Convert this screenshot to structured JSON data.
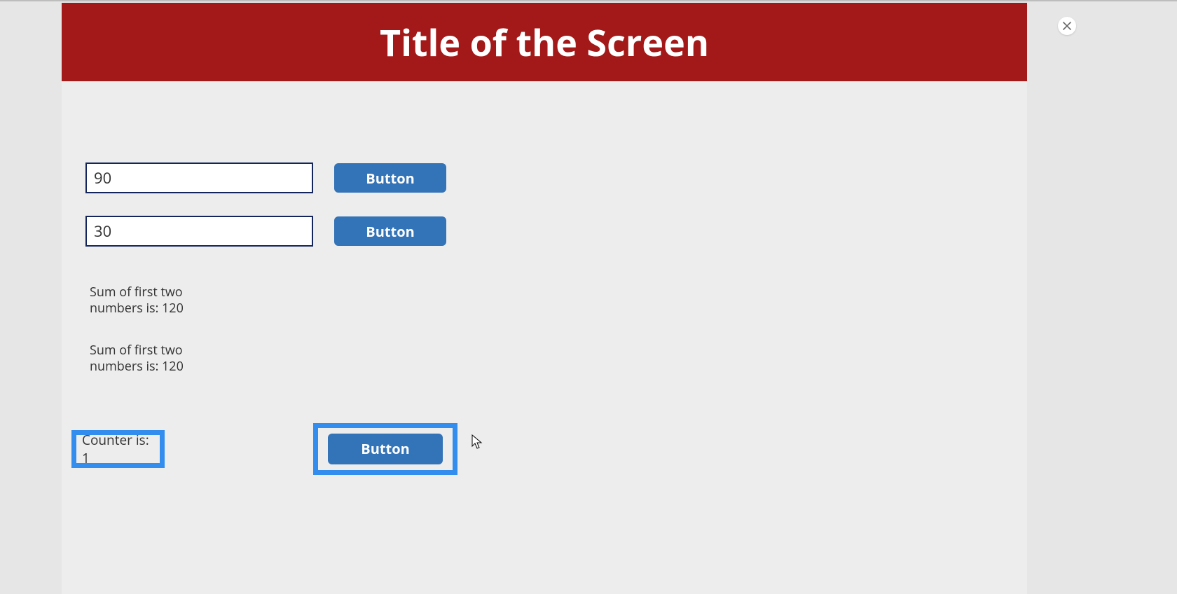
{
  "header": {
    "title": "Title of the Screen"
  },
  "inputs": {
    "first": {
      "value": "90",
      "button_label": "Button"
    },
    "second": {
      "value": "30",
      "button_label": "Button"
    }
  },
  "results": {
    "sum1": "Sum of first two numbers is: 120",
    "sum2": "Sum of first two numbers is: 120"
  },
  "counter": {
    "label": "Counter is: 1",
    "button_label": "Button"
  },
  "close": {
    "icon_name": "close-icon"
  }
}
